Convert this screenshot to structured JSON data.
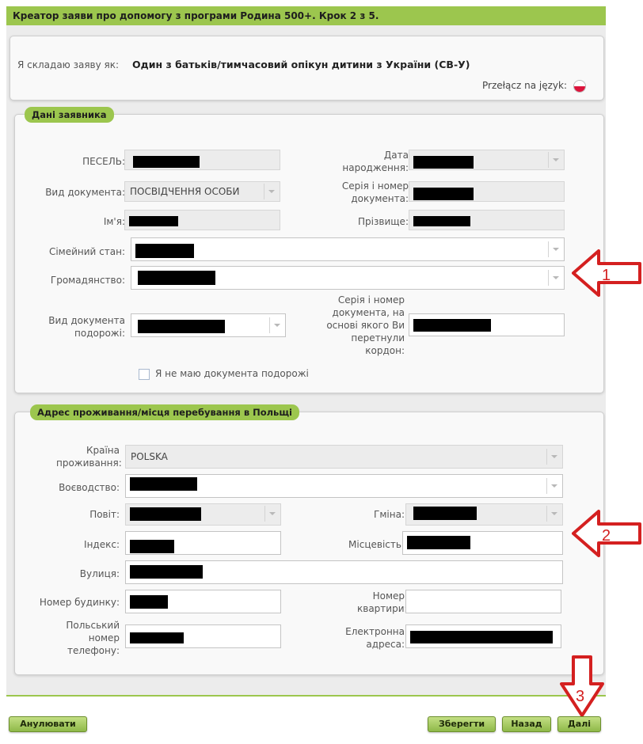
{
  "wizard": {
    "title": "Креатор заяви про допомогу з програми Родина 500+. Крок 2 з 5."
  },
  "header_panel": {
    "role_label": "Я складаю заяву як:",
    "role_value": "Один з батьків/тимчасовий опікун дитини з України (СВ-У)",
    "language_switch_label": "Przełącz na język:"
  },
  "applicant": {
    "legend": "Дані заявника",
    "pesel_label": "ПЕСЕЛЬ:",
    "birth_date_label": "Дата народження:",
    "document_type_label": "Вид документа:",
    "document_type_value": "ПОСВІДЧЕННЯ ОСОБИ",
    "document_number_label": "Серія і номер документа:",
    "first_name_label": "Ім'я:",
    "last_name_label": "Прізвище:",
    "marital_status_label": "Сімейний стан:",
    "citizenship_label": "Громадянство:",
    "travel_doc_type_label": "Вид документа подорожі:",
    "border_doc_number_label": "Серія і номер документа, на основі якого Ви перетнули кордон:",
    "no_travel_doc_label": "Я не маю документа подорожі"
  },
  "address": {
    "legend": "Адрес проживання/місця перебування в Польщі",
    "country_label": "Країна проживання:",
    "country_value": "POLSKA",
    "voivodeship_label": "Воєводство:",
    "district_label": "Повіт:",
    "commune_label": "Гміна:",
    "postcode_label": "Індекс:",
    "locality_label": "Місцевість:",
    "street_label": "Вулиця:",
    "house_number_label": "Номер будинку:",
    "apartment_label": "Номер квартири:",
    "phone_label": "Польський номер телефону:",
    "email_label": "Електронна адреса:"
  },
  "annotations": {
    "marker_1": "1",
    "marker_2": "2",
    "marker_3": "3",
    "color": "#d42020"
  },
  "footer": {
    "cancel_label": "Анулювати",
    "save_label": "Зберегти",
    "back_label": "Назад",
    "next_label": "Далі"
  }
}
